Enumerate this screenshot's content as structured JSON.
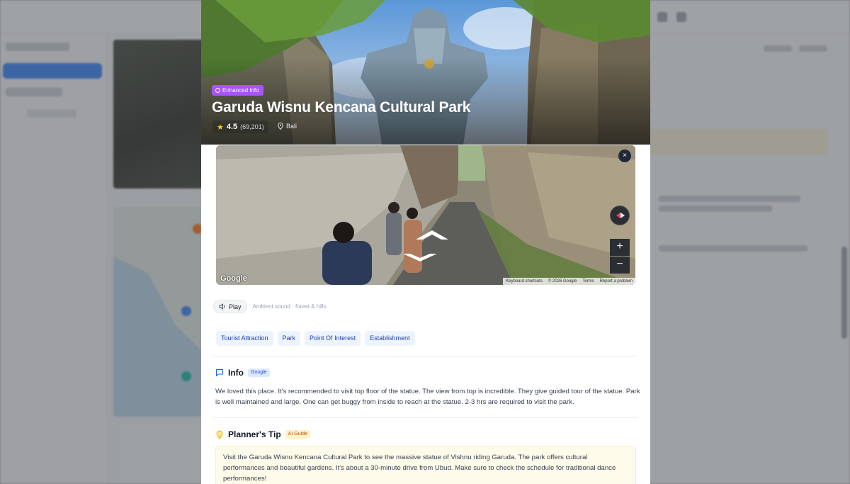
{
  "hero": {
    "badge": "Enhanced Info",
    "title": "Garuda Wisnu Kencana Cultural Park",
    "rating": "4.5",
    "review_count": "(69,201)",
    "location": "Bali"
  },
  "street_view": {
    "close_label": "×",
    "google_logo": "Google",
    "zoom_in": "+",
    "zoom_out": "−",
    "footer": {
      "shortcuts": "Keyboard shortcuts",
      "copyright": "© 2026 Google",
      "terms": "Terms",
      "report": "Report a problem"
    }
  },
  "audio": {
    "play_label": "Play",
    "description": "Ambient sound · forest & hills"
  },
  "tags": [
    "Tourist Attraction",
    "Park",
    "Point Of Interest",
    "Establishment"
  ],
  "info": {
    "title": "Info",
    "source_badge": "Google",
    "text": "We loved this place. It's recommended to visit top floor of the statue. The view from top is incredible. They give guided tour of the statue. Park is well maintained and large. One can get buggy from inside to reach at the statue. 2-3 hrs are required to visit the park."
  },
  "tip": {
    "title": "Planner's Tip",
    "source_badge": "AI Guide",
    "text": "Visit the Garuda Wisnu Kencana Cultural Park to see the massive statue of Vishnu riding Garuda. The park offers cultural performances and beautiful gardens. It's about a 30-minute drive from Ubud. Make sure to check the schedule for traditional dance performances!"
  },
  "colors": {
    "enhanced_badge": "#a855f7",
    "tag_text": "#1e40af",
    "tag_bg": "#eef4fd",
    "tip_bg": "#fefbea"
  },
  "icons": {
    "enhanced": "info-circle-icon",
    "star": "star-icon",
    "location": "map-pin-icon",
    "close": "close-icon",
    "compass": "compass-icon",
    "speaker": "speaker-icon",
    "info": "chat-bubble-icon",
    "tip": "lightbulb-icon"
  }
}
